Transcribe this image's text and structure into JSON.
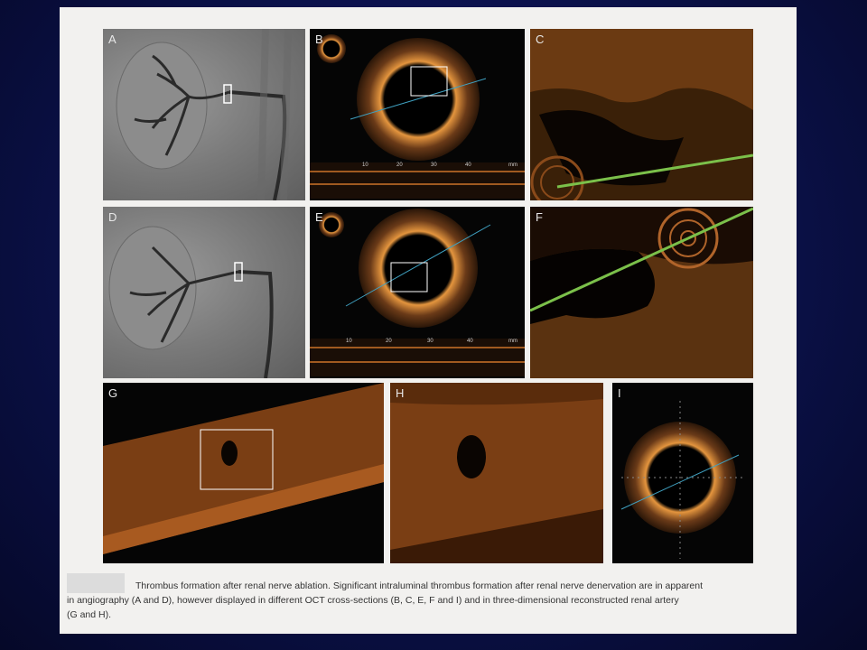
{
  "panels": {
    "a": "A",
    "b": "B",
    "c": "C",
    "d": "D",
    "e": "E",
    "f": "F",
    "g": "G",
    "h": "H",
    "i": "I"
  },
  "scale_ticks": [
    "10",
    "20",
    "30",
    "40",
    "mm"
  ],
  "caption": {
    "line1": "Thrombus formation after renal nerve ablation. Significant intraluminal thrombus formation after renal nerve denervation are in apparent",
    "line2": "in angiography (A and D), however displayed in different OCT cross-sections (B, C, E, F and I) and in three-dimensional reconstructed renal artery",
    "line3": "(G and H)."
  },
  "colors": {
    "oct": "#d88a3c",
    "background": "#0c1350",
    "paper": "#f2f1ef"
  }
}
